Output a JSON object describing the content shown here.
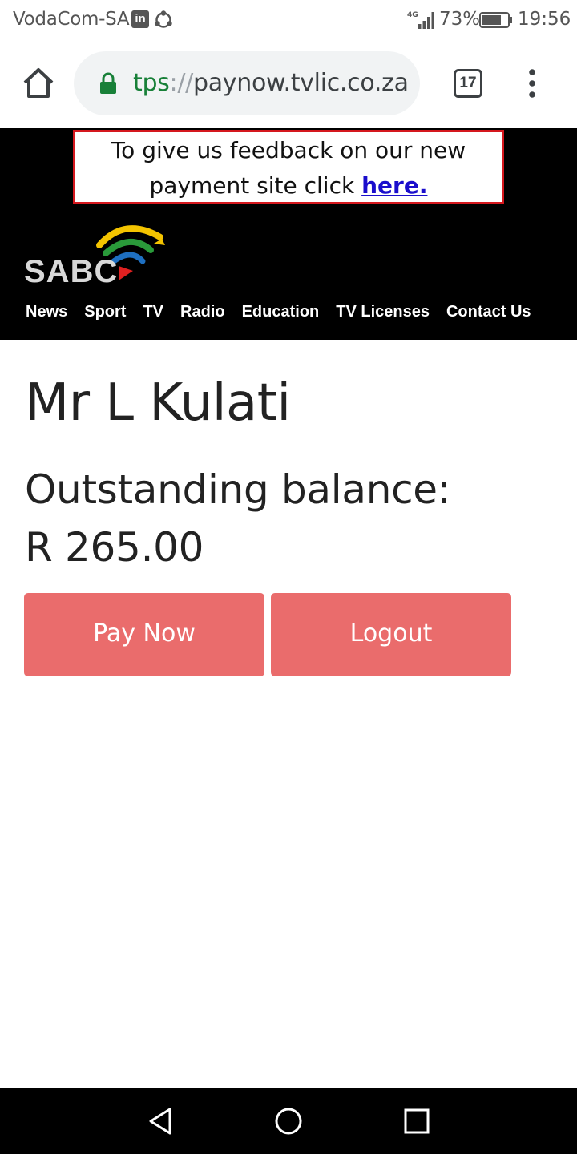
{
  "status_bar": {
    "carrier": "VodaCom-SA",
    "network": "4G",
    "battery": "73%",
    "time": "19:56"
  },
  "browser": {
    "url_scheme": "tps",
    "url_sep": "://",
    "url_host": "paynow.tvlic.co.za",
    "tab_count": "17"
  },
  "feedback": {
    "text_before": "To give us feedback on our new payment site click ",
    "link": "here."
  },
  "logo": {
    "text": "SABC",
    "colors": [
      "#f4c400",
      "#2a9a3a",
      "#1e6fc0",
      "#e02020"
    ]
  },
  "nav": {
    "items": [
      "News",
      "Sport",
      "TV",
      "Radio",
      "Education",
      "TV Licenses",
      "Contact Us"
    ]
  },
  "account": {
    "name": "Mr L Kulati",
    "balance_label": "Outstanding balance:",
    "balance_value": "R 265.00"
  },
  "buttons": {
    "pay_now": "Pay Now",
    "logout": "Logout"
  },
  "colors": {
    "button": "#ea6c6c",
    "feedback_border": "#d5181e",
    "link": "#1a0dcc",
    "secure": "#188038"
  }
}
